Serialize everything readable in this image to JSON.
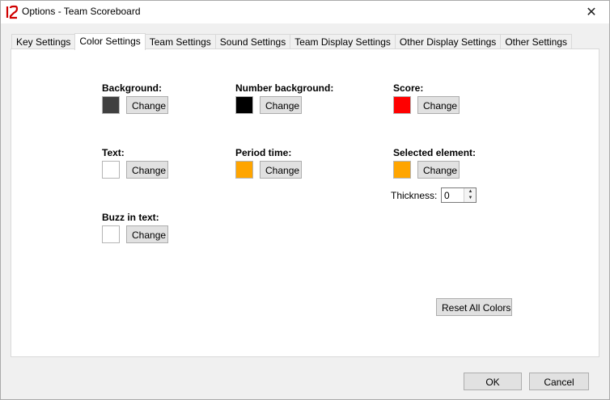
{
  "window": {
    "title": "Options - Team Scoreboard",
    "close_glyph": "✕"
  },
  "tabs": [
    {
      "label": "Key Settings",
      "active": false
    },
    {
      "label": "Color Settings",
      "active": true
    },
    {
      "label": "Team Settings",
      "active": false
    },
    {
      "label": "Sound Settings",
      "active": false
    },
    {
      "label": "Team Display Settings",
      "active": false
    },
    {
      "label": "Other Display Settings",
      "active": false
    },
    {
      "label": "Other Settings",
      "active": false
    }
  ],
  "colors": {
    "background": {
      "label": "Background:",
      "swatch": "#404040",
      "button": "Change"
    },
    "number_background": {
      "label": "Number background:",
      "swatch": "#000000",
      "button": "Change"
    },
    "score": {
      "label": "Score:",
      "swatch": "#ff0000",
      "button": "Change"
    },
    "text": {
      "label": "Text:",
      "swatch": "#ffffff",
      "button": "Change"
    },
    "period_time": {
      "label": "Period time:",
      "swatch": "#ffa500",
      "button": "Change"
    },
    "selected_element": {
      "label": "Selected element:",
      "swatch": "#ffa500",
      "button": "Change"
    },
    "buzz_in_text": {
      "label": "Buzz in text:",
      "swatch": "#ffffff",
      "button": "Change"
    }
  },
  "thickness": {
    "label": "Thickness:",
    "value": "0"
  },
  "reset_button": "Reset All Colors",
  "footer": {
    "ok": "OK",
    "cancel": "Cancel"
  },
  "icons": {
    "app": "scoreboard-12-icon",
    "spin_up": "▲",
    "spin_down": "▼"
  }
}
